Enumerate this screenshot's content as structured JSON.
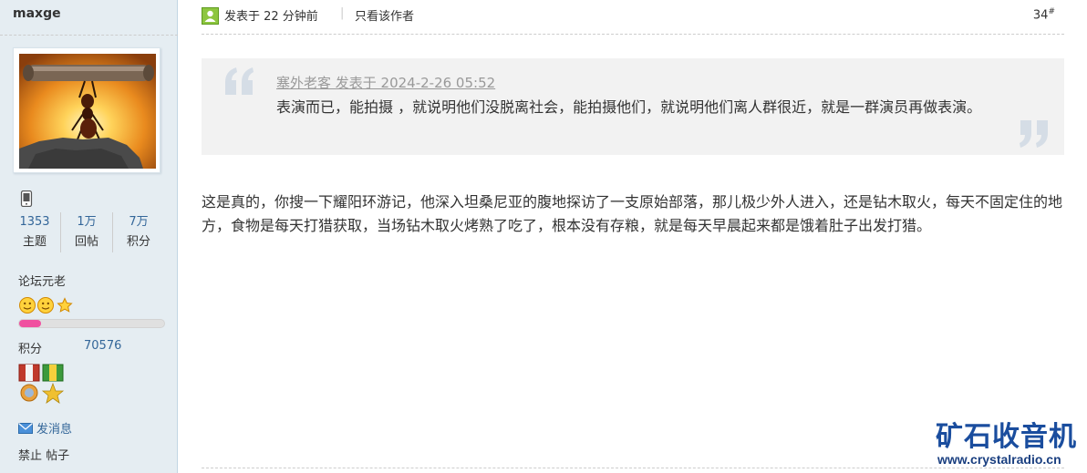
{
  "user": {
    "name": "maxge",
    "stats": [
      {
        "value": "1353",
        "label": "主题"
      },
      {
        "value": "1万",
        "label": "回帖"
      },
      {
        "value": "7万",
        "label": "积分"
      }
    ],
    "rank_title": "论坛元老",
    "rank_progress_percent": 15,
    "credit_label": "积分",
    "credit_value": "70576",
    "send_message": "发消息",
    "ban_posts": "禁止 帖子"
  },
  "post": {
    "time_text": "发表于 22 分钟前",
    "separator": "|",
    "only_author": "只看该作者",
    "floor_number": "34",
    "floor_suffix": "#"
  },
  "quote": {
    "meta": "塞外老客 发表于 2024-2-26 05:52",
    "text": "表演而已，能拍摄 ，就说明他们没脱离社会，能拍摄他们，就说明他们离人群很近，就是一群演员再做表演。"
  },
  "message": "这是真的，你搜一下耀阳环游记，他深入坦桑尼亚的腹地探访了一支原始部落，那儿极少外人进入，还是钻木取火，每天不固定住的地方，食物是每天打猎获取，当场钻木取火烤熟了吃了，根本没有存粮，就是每天早晨起来都是饿着肚子出发打猎。",
  "watermark": {
    "logo": "矿石收音机",
    "url": "www.crystalradio.cn"
  },
  "colors": {
    "sidebar_bg": "#e5edf2",
    "link_blue": "#336699",
    "quote_bg": "#f2f2f2",
    "progress_pink": "#f050a0",
    "watermark_blue": "#1a4d9e"
  }
}
